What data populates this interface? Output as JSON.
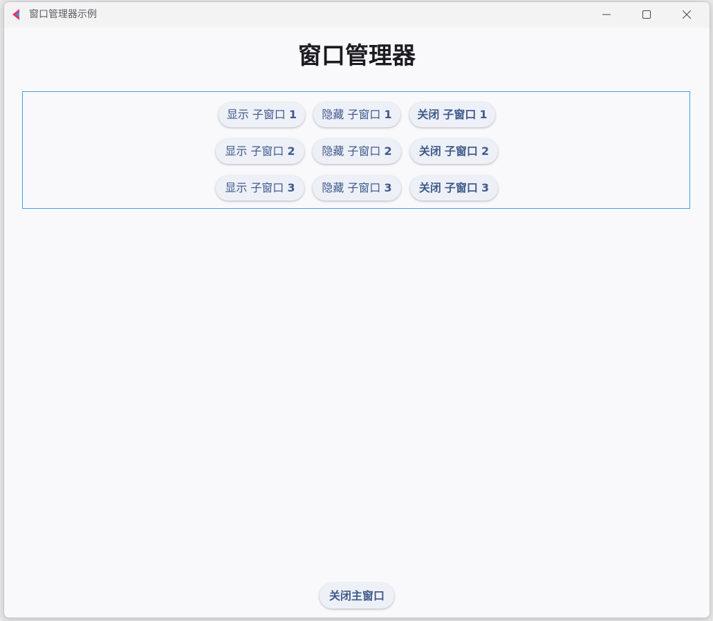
{
  "window": {
    "title": "窗口管理器示例"
  },
  "main": {
    "heading": "窗口管理器",
    "rows": [
      {
        "show": {
          "verb": "显示",
          "target": "子窗口",
          "num": "1"
        },
        "hide": {
          "verb": "隐藏",
          "target": "子窗口",
          "num": "1"
        },
        "close": {
          "verb": "关闭",
          "target": "子窗口",
          "num": "1"
        }
      },
      {
        "show": {
          "verb": "显示",
          "target": "子窗口",
          "num": "2"
        },
        "hide": {
          "verb": "隐藏",
          "target": "子窗口",
          "num": "2"
        },
        "close": {
          "verb": "关闭",
          "target": "子窗口",
          "num": "2"
        }
      },
      {
        "show": {
          "verb": "显示",
          "target": "子窗口",
          "num": "3"
        },
        "hide": {
          "verb": "隐藏",
          "target": "子窗口",
          "num": "3"
        },
        "close": {
          "verb": "关闭",
          "target": "子窗口",
          "num": "3"
        }
      }
    ],
    "close_main": {
      "verb": "关闭",
      "target": "主窗口"
    }
  },
  "colors": {
    "accent_border": "#3aa0e8",
    "button_text": "#3f5a8a",
    "button_bg": "#eef0f8"
  },
  "icons": {
    "app": "app-logo-icon",
    "minimize": "minimize-icon",
    "maximize": "maximize-icon",
    "close": "close-icon"
  }
}
